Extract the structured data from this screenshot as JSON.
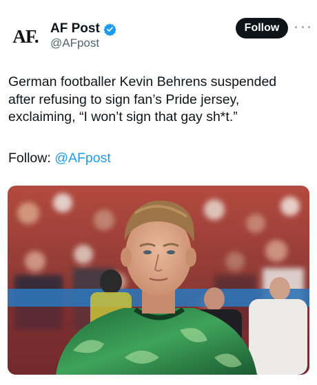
{
  "account": {
    "avatar_text": "AF.",
    "display_name": "AF Post",
    "handle": "@AFpost",
    "verified": true,
    "verified_color": "#1d9bf0"
  },
  "actions": {
    "follow_label": "Follow"
  },
  "tweet": {
    "line1": "German footballer Kevin Behrens suspended",
    "line2": "after refusing to sign fan’s Pride jersey,",
    "line3": "exclaiming, “I won’t sign that gay sh*t.”",
    "follow_prefix": "Follow: ",
    "follow_mention": "@AFpost"
  },
  "media": {
    "type": "photo",
    "subject": "footballer in green patterned warm-up shirt, stadium crowd background"
  }
}
